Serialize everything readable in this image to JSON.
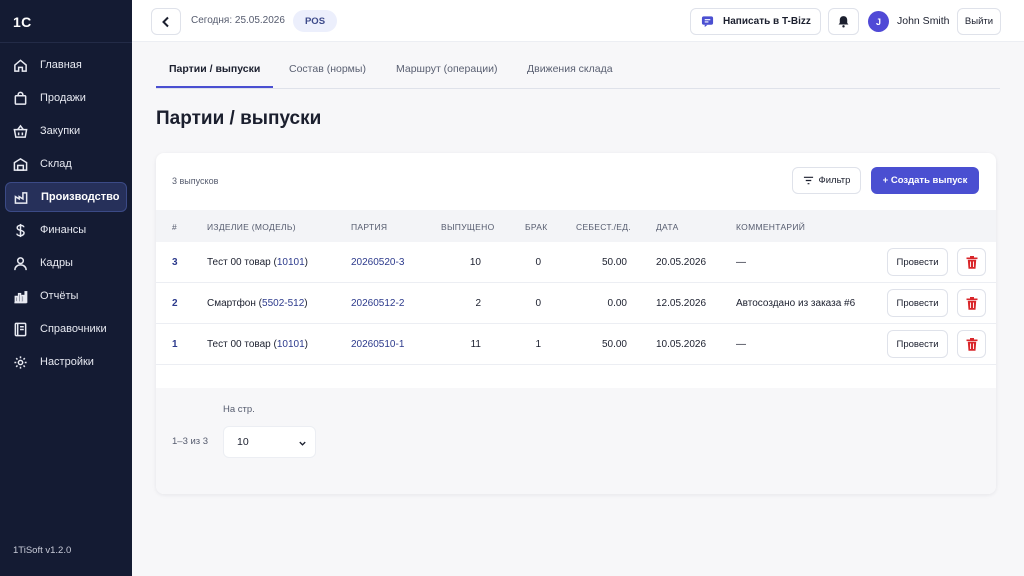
{
  "sidebar": {
    "brand": "1С",
    "items": [
      {
        "label": "Главная",
        "icon": "home-icon"
      },
      {
        "label": "Продажи",
        "icon": "bag-icon"
      },
      {
        "label": "Закупки",
        "icon": "basket-icon"
      },
      {
        "label": "Склад",
        "icon": "warehouse-icon"
      },
      {
        "label": "Производство",
        "icon": "factory-icon",
        "active": true
      },
      {
        "label": "Финансы",
        "icon": "dollar-icon"
      },
      {
        "label": "Кадры",
        "icon": "user-icon"
      },
      {
        "label": "Отчёты",
        "icon": "bar-chart-icon"
      },
      {
        "label": "Справочники",
        "icon": "book-icon"
      },
      {
        "label": "Настройки",
        "icon": "gear-icon"
      }
    ],
    "version": "1TiSoft v1.2.0"
  },
  "header": {
    "today": "Сегодня: 25.05.2026",
    "badge": "POS",
    "tbizz_label": "Написать в T-Bizz",
    "avatar_initial": "J",
    "username": "John Smith",
    "logout_label": "Выйти"
  },
  "tabs": [
    {
      "label": "Партии / выпуски",
      "active": true
    },
    {
      "label": "Состав (нормы)"
    },
    {
      "label": "Маршрут (операции)"
    },
    {
      "label": "Движения склада"
    }
  ],
  "page_title": "Партии / выпуски",
  "toolbar": {
    "count_text": "3 выпусков",
    "filter_label": "Фильтр",
    "create_label": "+ Создать выпуск"
  },
  "table": {
    "headers": [
      "#",
      "ИЗДЕЛИЕ (МОДЕЛЬ)",
      "ПАРТИЯ",
      "ВЫПУЩЕНО",
      "БРАК",
      "СЕБЕСТ./ЕД.",
      "ДАТА",
      "КОММЕНТАРИЙ"
    ],
    "rows": [
      {
        "id": "3",
        "product": "Тест 00 товар",
        "model": "10101",
        "batch": "20260520-3",
        "released": "10",
        "defect": "0",
        "cost": "50.00",
        "date": "20.05.2026",
        "comment": "—"
      },
      {
        "id": "2",
        "product": "Смартфон",
        "model": "5502-512",
        "batch": "20260512-2",
        "released": "2",
        "defect": "0",
        "cost": "0.00",
        "date": "12.05.2026",
        "comment": "Автосоздано из заказа #6"
      },
      {
        "id": "1",
        "product": "Тест 00 товар",
        "model": "10101",
        "batch": "20260510-1",
        "released": "11",
        "defect": "1",
        "cost": "50.00",
        "date": "10.05.2026",
        "comment": "—"
      }
    ],
    "post_label": "Провести"
  },
  "pagination": {
    "per_page_label": "На стр.",
    "range": "1–3 из 3",
    "per_page_value": "10"
  },
  "colors": {
    "sidebar_bg": "#141b33",
    "accent": "#4a4fd1",
    "delete": "#d9262a"
  }
}
